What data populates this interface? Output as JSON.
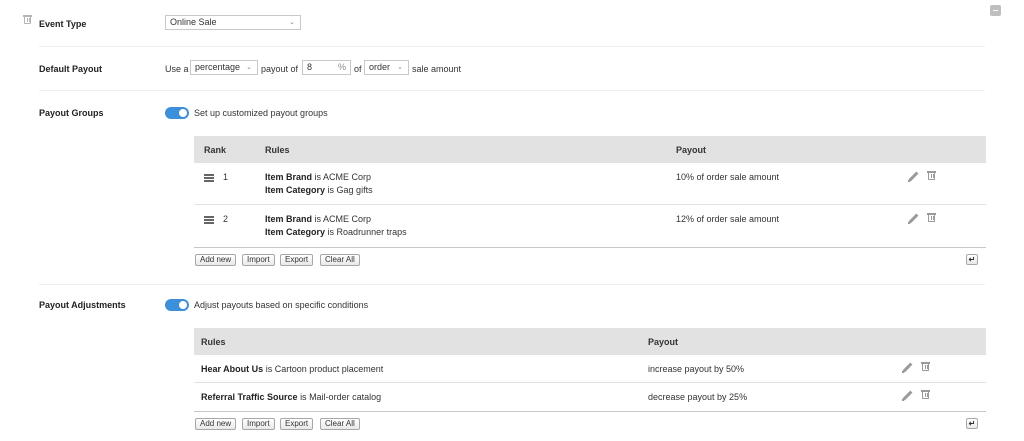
{
  "event_type": {
    "label": "Event Type",
    "value": "Online Sale"
  },
  "default_payout": {
    "label": "Default Payout",
    "prefix": "Use a",
    "type_value": "percentage",
    "mid": "payout of",
    "amount": "8",
    "unit": "%",
    "of_text": "of",
    "basis_value": "order",
    "suffix": "sale amount"
  },
  "payout_groups": {
    "label": "Payout Groups",
    "toggle_text": "Set up customized payout groups",
    "headers": {
      "rank": "Rank",
      "rules": "Rules",
      "payout": "Payout"
    },
    "rows": [
      {
        "rank": "1",
        "rule1_field": "Item Brand",
        "rule1_rest": "is ACME Corp",
        "rule2_field": "Item Category",
        "rule2_rest": "is Gag gifts",
        "payout": "10% of order sale amount"
      },
      {
        "rank": "2",
        "rule1_field": "Item Brand",
        "rule1_rest": "is ACME Corp",
        "rule2_field": "Item Category",
        "rule2_rest": "is Roadrunner traps",
        "payout": "12% of order sale amount"
      }
    ],
    "buttons": {
      "add": "Add new",
      "import": "Import",
      "export": "Export",
      "clear": "Clear All"
    }
  },
  "payout_adjustments": {
    "label": "Payout Adjustments",
    "toggle_text": "Adjust payouts based on specific conditions",
    "headers": {
      "rules": "Rules",
      "payout": "Payout"
    },
    "rows": [
      {
        "field": "Hear About Us",
        "rest": "is Cartoon product placement",
        "payout": "increase payout by 50%"
      },
      {
        "field": "Referral Traffic Source",
        "rest": "is Mail-order catalog",
        "payout": "decrease payout by 25%"
      }
    ],
    "buttons": {
      "add": "Add new",
      "import": "Import",
      "export": "Export",
      "clear": "Clear All"
    }
  },
  "icons": {
    "remove": "trash-icon",
    "collapse": "minus-square-icon",
    "edit": "pencil-icon",
    "drag": "drag-handle-icon",
    "corner": "return-arrow-icon",
    "chevron": "chevron-down-icon"
  },
  "colors": {
    "toggle_on": "#3d8fd9",
    "grid_header": "#e2e2e2"
  }
}
